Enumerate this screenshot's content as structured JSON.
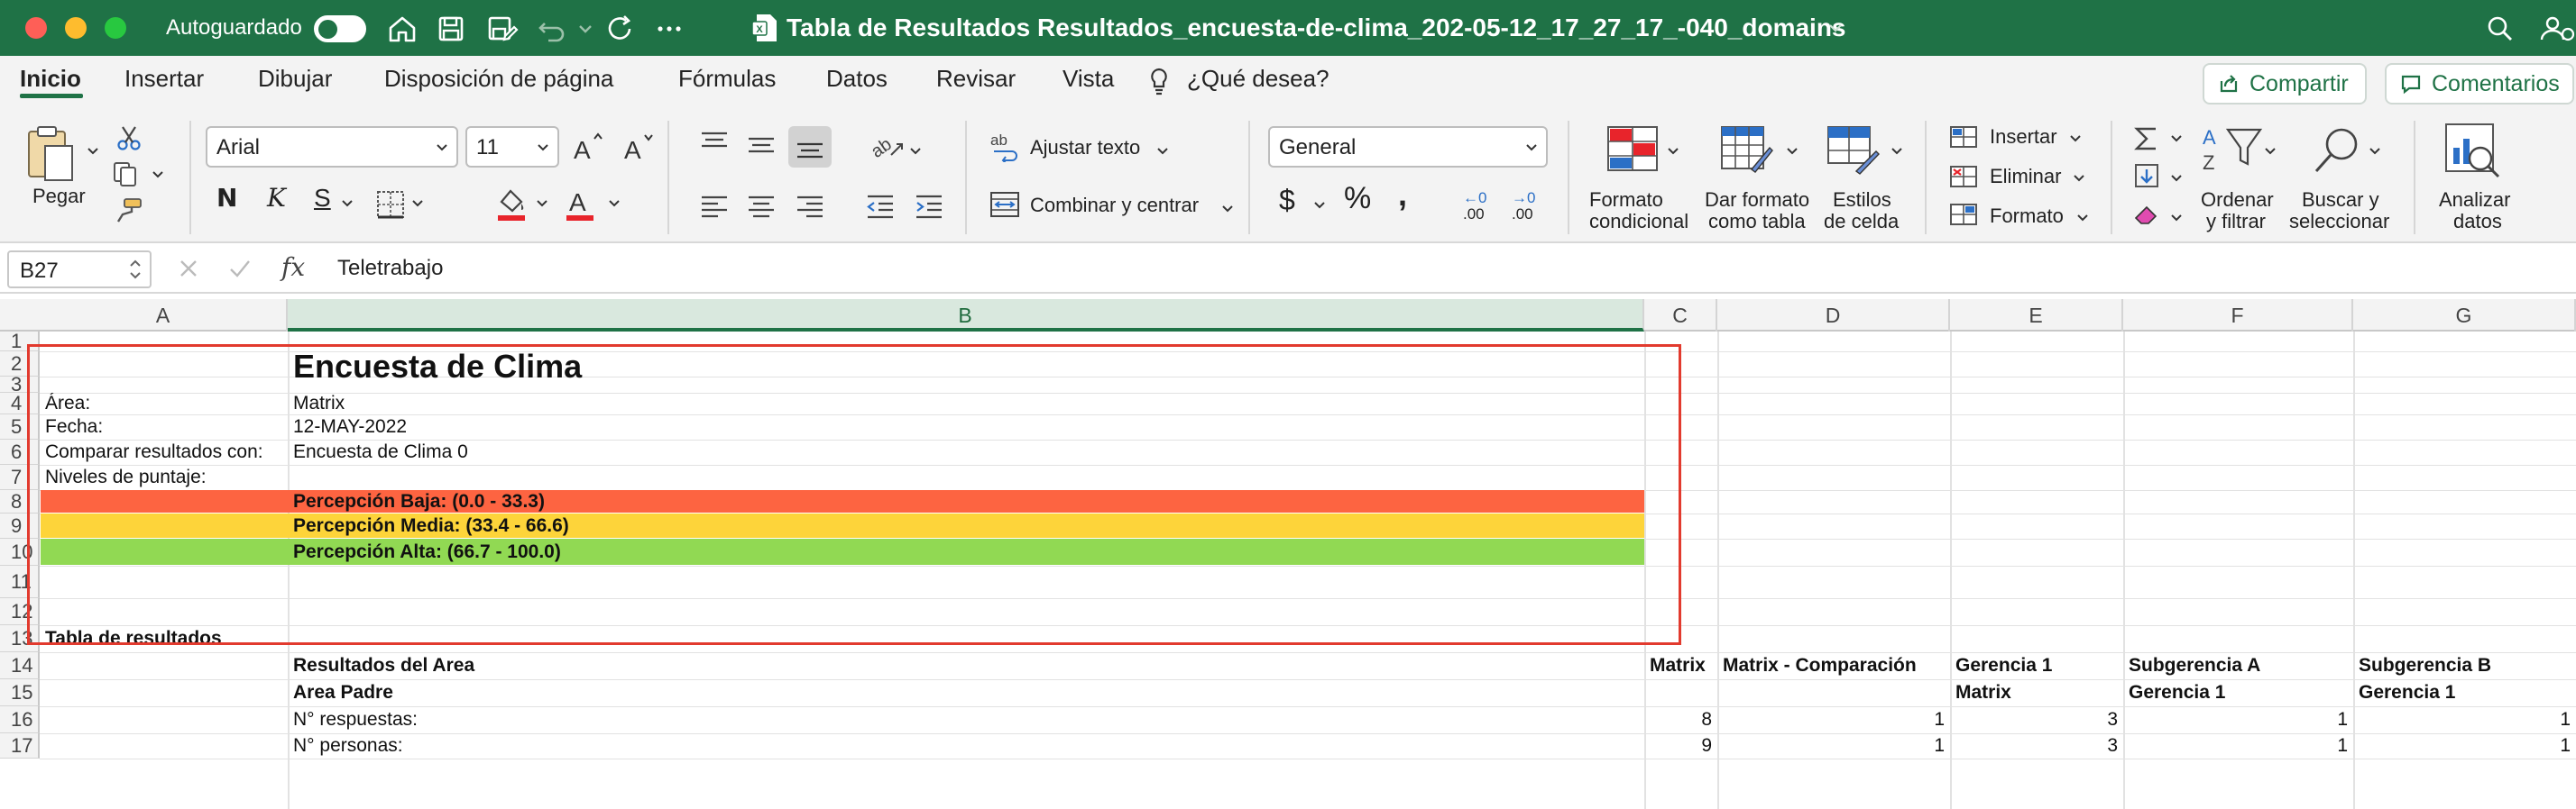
{
  "titlebar": {
    "autosave_label": "Autoguardado",
    "autosave_state": "off",
    "window_title": "Tabla de Resultados Resultados_encuesta-de-clima_202-05-12_17_27_17_-040_domains",
    "colors": {
      "bar": "#1f7246"
    }
  },
  "tabs": [
    {
      "label": "Inicio",
      "active": true
    },
    {
      "label": "Insertar"
    },
    {
      "label": "Dibujar"
    },
    {
      "label": "Disposición de página"
    },
    {
      "label": "Fórmulas"
    },
    {
      "label": "Datos"
    },
    {
      "label": "Revisar"
    },
    {
      "label": "Vista"
    },
    {
      "label": "¿Qué desea?"
    }
  ],
  "share": {
    "label": "Compartir"
  },
  "comments": {
    "label": "Comentarios"
  },
  "ribbon": {
    "paste_label": "Pegar",
    "font_name": "Arial",
    "font_size": "11",
    "bold": "N",
    "italic": "K",
    "underline": "S",
    "wrap_text": "Ajustar texto",
    "merge_center": "Combinar y centrar",
    "number_format": "General",
    "currency": "$",
    "percent": "%",
    "comma": ",",
    "dec_increase": ".00",
    "dec_decrease": ".00",
    "dec_inc_top": "←0",
    "dec_dec_top": "→0",
    "conditional_format": [
      "Formato",
      "condicional"
    ],
    "format_table": [
      "Dar formato",
      "como tabla"
    ],
    "cell_styles": [
      "Estilos",
      "de celda"
    ],
    "insert": "Insertar",
    "delete": "Eliminar",
    "format": "Formato",
    "sort_filter": [
      "Ordenar",
      "y filtrar"
    ],
    "find_select": [
      "Buscar y",
      "seleccionar"
    ],
    "analyze": [
      "Analizar",
      "datos"
    ]
  },
  "formula_bar": {
    "name_box": "B27",
    "fx": "fx",
    "content": "Teletrabajo"
  },
  "columns": [
    "A",
    "B",
    "C",
    "D",
    "E",
    "F",
    "G"
  ],
  "selected_column": "B",
  "rows": [
    "1",
    "2",
    "3",
    "4",
    "5",
    "6",
    "7",
    "8",
    "9",
    "10",
    "11",
    "12",
    "13",
    "14",
    "15",
    "16",
    "17"
  ],
  "sheet": {
    "title": "Encuesta de Clima",
    "info": [
      {
        "label": "Área:",
        "value": "Matrix"
      },
      {
        "label": "Fecha:",
        "value": "12-MAY-2022"
      },
      {
        "label": "Comparar resultados con:",
        "value": "Encuesta de Clima 0"
      },
      {
        "label": "Niveles de puntaje:",
        "value": ""
      }
    ],
    "levels": [
      {
        "label": "Percepción Baja: (0.0 - 33.3)",
        "color": "#fd6441"
      },
      {
        "label": "Percepción Media: (33.4 - 66.6)",
        "color": "#fdd43a"
      },
      {
        "label": "Percepción Alta: (66.7 - 100.0)",
        "color": "#91d953"
      }
    ],
    "table_heading": "Tabla de resultados",
    "row14": {
      "b": "Resultados del Area",
      "c": "Matrix",
      "d": "Matrix - Comparación",
      "e": "Gerencia 1",
      "f": "Subgerencia A",
      "g": "Subgerencia B"
    },
    "row15": {
      "b": "Area Padre",
      "e": "Matrix",
      "f": "Gerencia 1",
      "g": "Gerencia 1"
    },
    "row16": {
      "b": "N° respuestas:",
      "c": "8",
      "d": "1",
      "e": "3",
      "f": "1",
      "g": "1"
    },
    "row17": {
      "b": "N° personas:",
      "c": "9",
      "d": "1",
      "e": "3",
      "f": "1",
      "g": "1"
    }
  }
}
